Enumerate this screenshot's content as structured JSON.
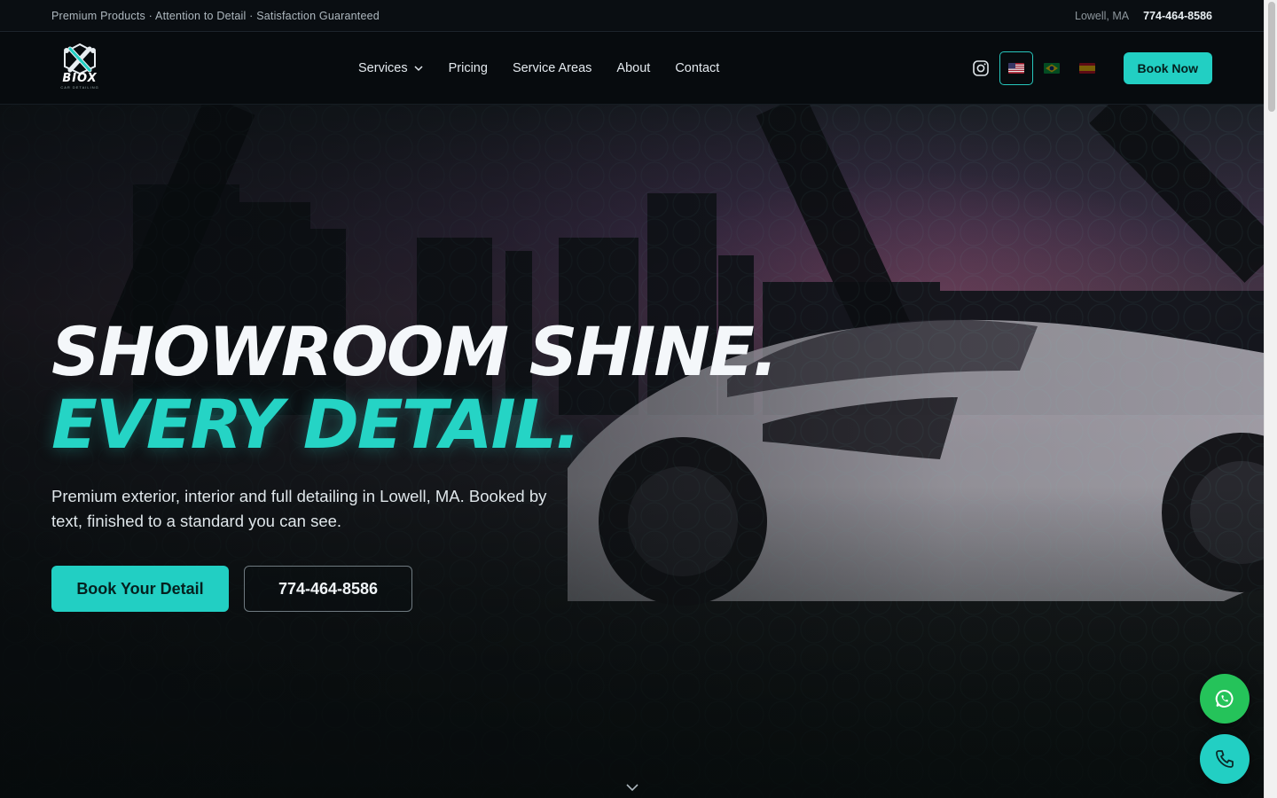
{
  "topbar": {
    "tagline": "Premium Products · Attention to Detail · Satisfaction Guaranteed",
    "location": "Lowell, MA",
    "phone": "774-464-8586"
  },
  "brand": {
    "name": "BIOX",
    "sub": "CAR DETAILING"
  },
  "nav": {
    "items": [
      {
        "label": "Services",
        "has_dropdown": true
      },
      {
        "label": "Pricing"
      },
      {
        "label": "Service Areas"
      },
      {
        "label": "About"
      },
      {
        "label": "Contact"
      }
    ],
    "icons": [
      "instagram-icon",
      "us-flag-icon",
      "brazil-flag-icon",
      "spain-flag-icon"
    ],
    "book_now": "Book Now"
  },
  "hero": {
    "headline_1": "SHOWROOM SHINE.",
    "headline_2": "EVERY DETAIL.",
    "subtitle": "Premium exterior, interior and full detailing in Lowell, MA. Booked by text, finished to a standard you can see.",
    "primary_cta": "Book Your Detail",
    "secondary_cta": "774-464-8586"
  },
  "colors": {
    "accent": "#22cfc3",
    "whatsapp": "#25c35a",
    "background": "#06090c"
  }
}
